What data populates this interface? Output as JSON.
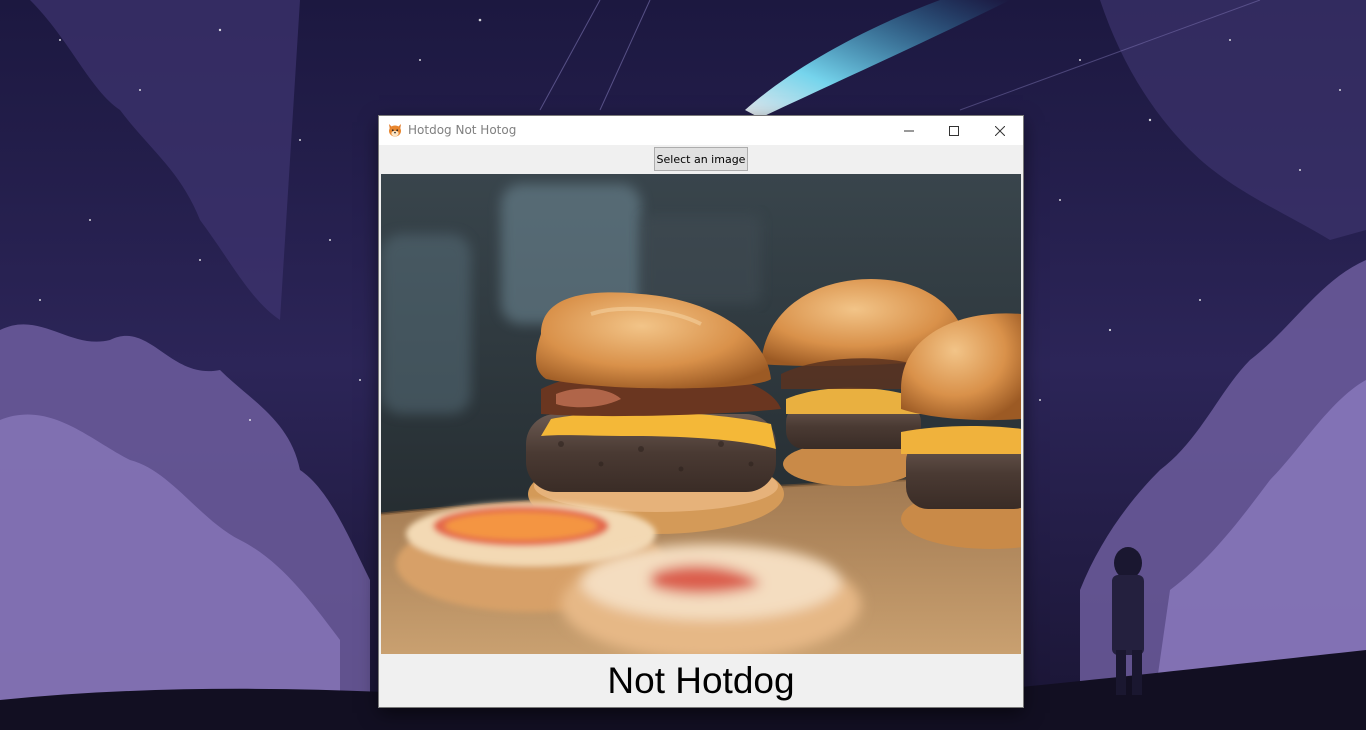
{
  "window": {
    "title": "Hotdog Not Hotog",
    "icon": "shiba-dog-icon"
  },
  "controls": {
    "select_button_label": "Select an image"
  },
  "image": {
    "subject": "burgers-photo"
  },
  "result": {
    "label": "Not Hotdog"
  }
}
